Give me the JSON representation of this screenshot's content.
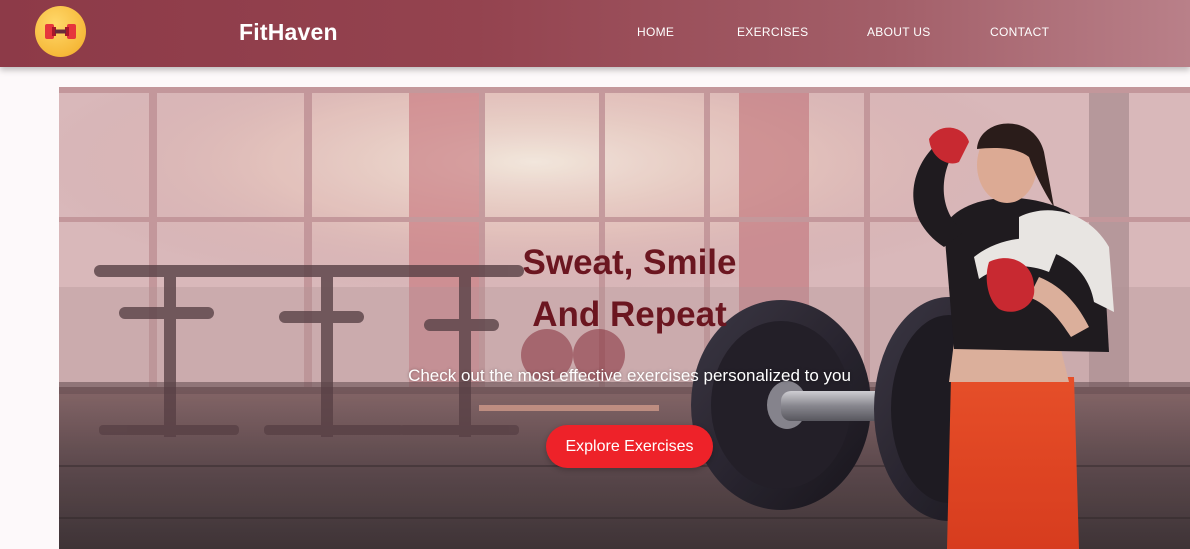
{
  "navbar": {
    "logo_icon": "dumbbell-icon",
    "brand": "FitHaven",
    "links": {
      "home": "HOME",
      "exercises": "EXERCISES",
      "about": "ABOUT US",
      "contact": "CONTACT"
    },
    "gradient_colors": [
      "#8d3a48",
      "#b98089"
    ]
  },
  "hero": {
    "title_line1": "Sweat, Smile",
    "title_line2": "And Repeat",
    "subtitle": "Check out the most effective exercises personalized to you",
    "cta_label": "Explore Exercises",
    "title_color": "#6b1620",
    "cta_color": "#ee2229",
    "image": "gym-hero-photo"
  }
}
